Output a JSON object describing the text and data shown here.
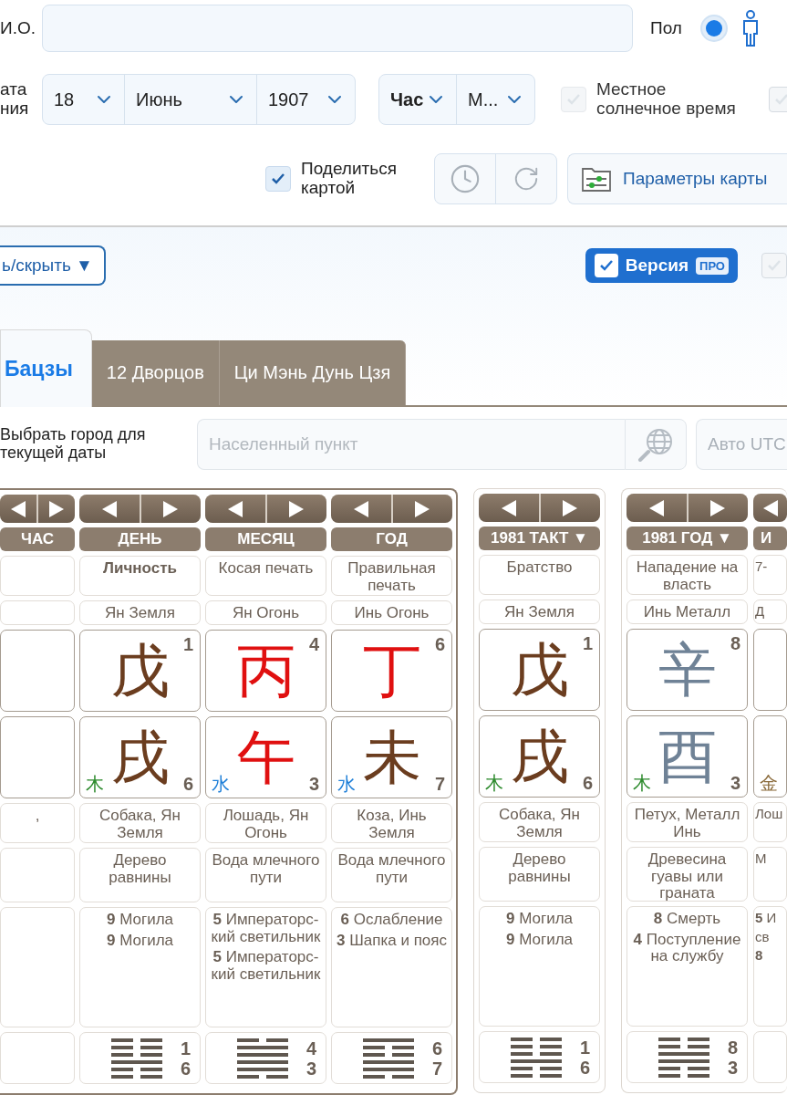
{
  "form": {
    "name": {
      "label": "И.О."
    },
    "gender": {
      "label": "Пол",
      "selected": true
    },
    "birth": {
      "label_lines": [
        "ата",
        "ния"
      ],
      "day": "18",
      "month": "Июнь",
      "year": "1907",
      "hour": "Час",
      "minute": "М..."
    },
    "solar_time": {
      "label": "Местное солнечное время",
      "checked": false,
      "disabled": true
    },
    "extra_checkbox": {
      "checked": false
    },
    "share": {
      "label": "Поделиться картой",
      "checked": true
    },
    "params_button": "Параметры карты"
  },
  "toolbar": {
    "toggle_button": "ь/скрыть ▼",
    "pro": {
      "label": "Версия",
      "badge": "ПРО",
      "checked": true
    },
    "extra_checkbox": {
      "checked": false
    }
  },
  "tabs": [
    {
      "label": "Бацзы",
      "selected": true
    },
    {
      "label": "12 Дворцов",
      "selected": false
    },
    {
      "label": "Ци Мэнь Дунь Цзя",
      "selected": false
    }
  ],
  "city": {
    "label": "Выбрать город для текущей даты",
    "placeholder": "Населенный пункт",
    "utc_placeholder": "Авто UTC"
  },
  "panels": [
    {
      "kind": "main",
      "columns": [
        {
          "kind": "cut_left",
          "header": "ЧАС",
          "animal": ","
        },
        {
          "kind": "full",
          "header": "ДЕНЬ",
          "star": "Личность",
          "star_bold": true,
          "element": "Ян Земля",
          "stem": {
            "char": "戊",
            "color": "#6b3d1f",
            "number": "1"
          },
          "branch": {
            "char": "戌",
            "color": "#6b3d1f",
            "number": "6",
            "element": {
              "char": "木",
              "color": "#2e8b2e"
            }
          },
          "animal": "Собака, Ян Земля",
          "nayin": "Дерево равнины",
          "stages": [
            "**9** Могила",
            "**9** Могила"
          ],
          "hexagram": {
            "lines": [
              false,
              false,
              false,
              true,
              false,
              false
            ],
            "upper": "1",
            "lower": "6"
          }
        },
        {
          "kind": "full",
          "header": "МЕСЯЦ",
          "star": "Косая печать",
          "star_bold": false,
          "element": "Ян Огонь",
          "stem": {
            "char": "丙",
            "color": "#e01010",
            "number": "4"
          },
          "branch": {
            "char": "午",
            "color": "#e01010",
            "number": "3",
            "element": {
              "char": "水",
              "color": "#1e7fd8"
            }
          },
          "animal": "Лошадь, Ян Огонь",
          "nayin": "Вода млечного пути",
          "stages": [
            "**5** Императорс-кий светильник",
            "**5** Императорс-кий светильник"
          ],
          "hexagram": {
            "lines": [
              false,
              true,
              true,
              true,
              true,
              false
            ],
            "upper": "4",
            "lower": "3"
          }
        },
        {
          "kind": "full",
          "header": "ГОД",
          "star": "Правильная печать",
          "star_bold": false,
          "element": "Инь Огонь",
          "stem": {
            "char": "丁",
            "color": "#e01010",
            "number": "6"
          },
          "branch": {
            "char": "未",
            "color": "#6b3d1f",
            "number": "7",
            "element": {
              "char": "水",
              "color": "#1e7fd8"
            }
          },
          "animal": "Коза, Инь Земля",
          "nayin": "Вода млечного пути",
          "stages": [
            "**6** Ослабление",
            "**3** Шапка и пояс"
          ],
          "hexagram": {
            "lines": [
              true,
              false,
              false,
              true,
              true,
              false
            ],
            "upper": "6",
            "lower": "7"
          }
        }
      ]
    },
    {
      "kind": "luck",
      "columns": [
        {
          "kind": "full",
          "header": "1981 ТАКТ ▼",
          "star": "Братство",
          "star_bold": false,
          "element": "Ян Земля",
          "stem": {
            "char": "戊",
            "color": "#6b3d1f",
            "number": "1"
          },
          "branch": {
            "char": "戌",
            "color": "#6b3d1f",
            "number": "6",
            "element": {
              "char": "木",
              "color": "#2e8b2e"
            }
          },
          "animal": "Собака, Ян Земля",
          "nayin": "Дерево равнины",
          "stages": [
            "**9** Могила",
            "**9** Могила"
          ],
          "hexagram": {
            "lines": [
              false,
              false,
              false,
              true,
              false,
              false
            ],
            "upper": "1",
            "lower": "6"
          }
        }
      ]
    },
    {
      "kind": "annual",
      "columns": [
        {
          "kind": "full",
          "header": "1981 ГОД ▼",
          "star": "Нападение на власть",
          "star_bold": false,
          "element": "Инь Металл",
          "stem": {
            "char": "辛",
            "color": "#6f8296",
            "number": "8"
          },
          "branch": {
            "char": "酉",
            "color": "#6f8296",
            "number": "3",
            "element": {
              "char": "木",
              "color": "#2e8b2e"
            }
          },
          "animal": "Петух, Металл Инь",
          "nayin": "Древесина гуавы или граната",
          "stages": [
            "**8** Смерть",
            "**4** Поступление на службу"
          ],
          "hexagram": {
            "lines": [
              false,
              false,
              true,
              true,
              false,
              false
            ],
            "upper": "8",
            "lower": "3"
          }
        },
        {
          "kind": "cut_right",
          "header": "И",
          "star": "7-",
          "element": "Д",
          "branch": {
            "element": {
              "char": "金",
              "color": "#8a6a3a"
            }
          },
          "animal": "Лош",
          "nayin": "М",
          "stages": [
            "**5** И",
            "св",
            "**8**"
          ]
        }
      ]
    }
  ]
}
